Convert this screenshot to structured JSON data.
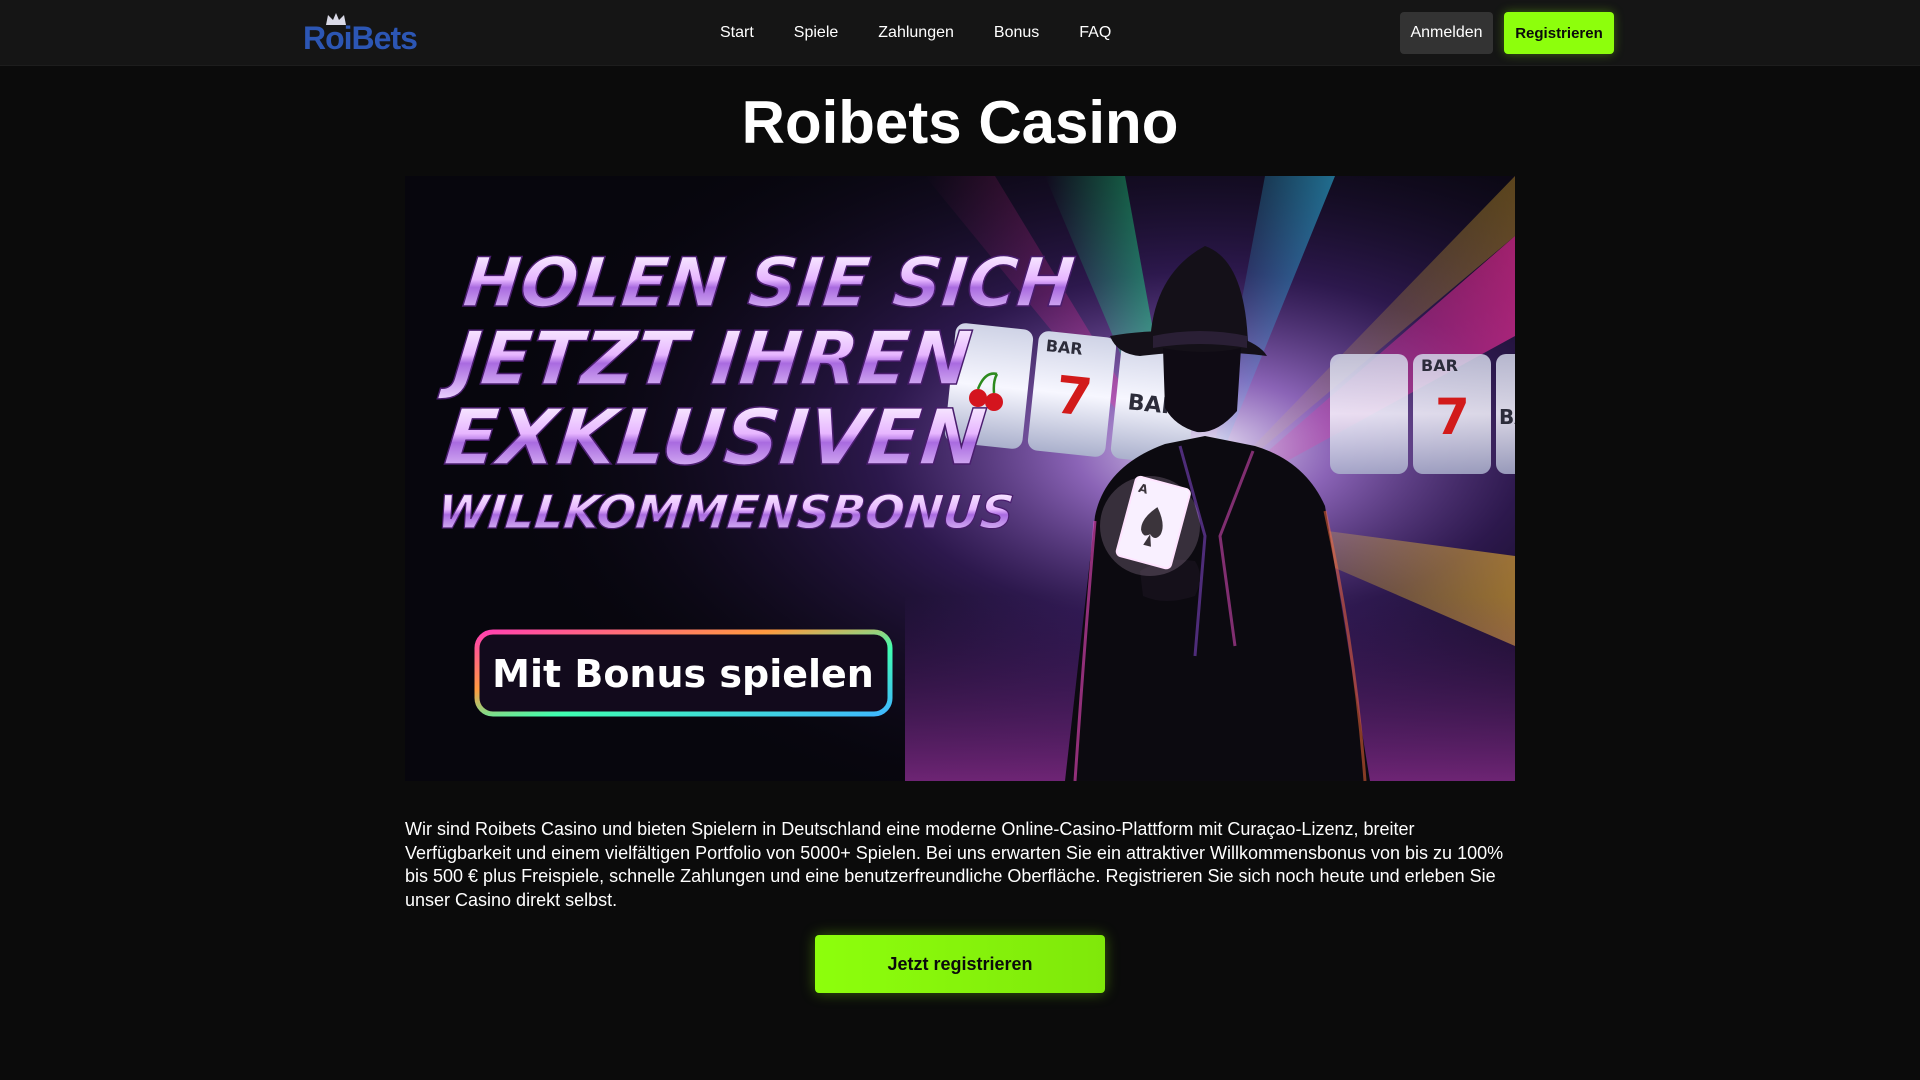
{
  "header": {
    "logo_text": "RoiBets",
    "nav": [
      "Start",
      "Spiele",
      "Zahlungen",
      "Bonus",
      "FAQ"
    ],
    "login_label": "Anmelden",
    "register_label": "Registrieren"
  },
  "main": {
    "title": "Roibets Casino",
    "banner": {
      "headline": [
        "HOLEN SIE SICH",
        "JETZT IHREN",
        "EXKLUSIVEN",
        "WILLKOMMENSBONUS"
      ],
      "button_label": "Mit Bonus spielen",
      "reel_symbols": [
        "BAR",
        "7",
        "BAR",
        "BAR",
        "7",
        "BAR"
      ]
    },
    "description": "Wir sind Roibets Casino und bieten Spielern in Deutschland eine moderne Online-Casino-Plattform mit Curaçao-Lizenz, breiter Verfügbarkeit und einem vielfältigen Portfolio von 5000+ Spielen. Bei uns erwarten Sie ein attraktiver Willkommensbonus von bis zu 100% bis 500 € plus Freispiele, schnelle Zahlungen und eine benutzerfreundliche Oberfläche. Registrieren Sie sich noch heute und erleben Sie unser Casino direkt selbst.",
    "cta_label": "Jetzt registrieren"
  },
  "colors": {
    "accent": "#8dff0c",
    "background": "#0b0b0b",
    "header": "#151515",
    "logo": "#2c56b4"
  },
  "icons": [
    "crown-icon",
    "cherry-icon",
    "spade-icon"
  ]
}
